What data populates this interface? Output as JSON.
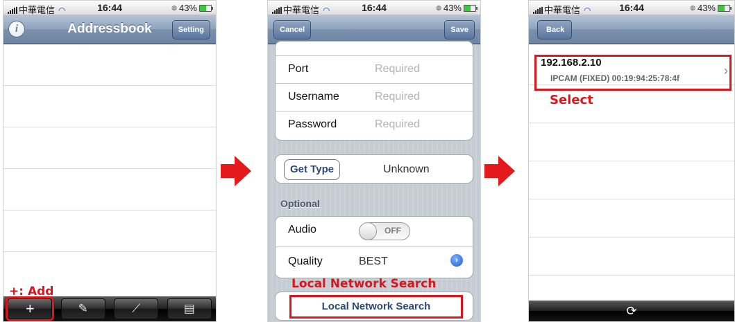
{
  "status": {
    "carrier": "中華電信",
    "time": "16:44",
    "battery": "43%"
  },
  "screen1": {
    "title": "Addressbook",
    "setting_button": "Setting",
    "info_icon": "i",
    "toolbar": [
      "+",
      "notes-icon",
      "chart-icon",
      "device-icon"
    ],
    "callout": "+: Add"
  },
  "screen2": {
    "cancel_button": "Cancel",
    "save_button": "Save",
    "fields": [
      {
        "label": "Port",
        "placeholder": "Required"
      },
      {
        "label": "Username",
        "placeholder": "Required"
      },
      {
        "label": "Password",
        "placeholder": "Required"
      }
    ],
    "get_type_button": "Get Type",
    "type_value": "Unknown",
    "optional_header": "Optional",
    "audio_label": "Audio",
    "audio_toggle": "OFF",
    "quality_label": "Quality",
    "quality_value": "BEST",
    "lns_callout": "Local Network Search",
    "lns_button": "Local Network Search"
  },
  "screen3": {
    "back_button": "Back",
    "device_ip": "192.168.2.10",
    "device_info": "IPCAM (FIXED)  00:19:94:25:78:4f",
    "select_callout": "Select"
  },
  "colors": {
    "accent_red": "#d8161c",
    "arrow_red": "#e3191c",
    "nav_blue": "#6d85a3"
  }
}
